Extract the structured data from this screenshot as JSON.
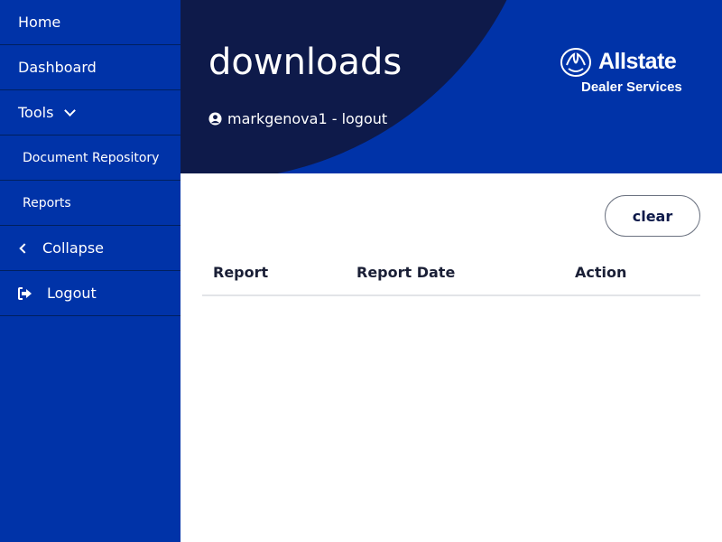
{
  "sidebar": {
    "items": [
      {
        "label": "Home"
      },
      {
        "label": "Dashboard"
      },
      {
        "label": "Tools"
      },
      {
        "label": "Document Repository"
      },
      {
        "label": "Reports"
      },
      {
        "label": "Collapse"
      },
      {
        "label": "Logout"
      }
    ]
  },
  "header": {
    "title": "downloads",
    "user_text": "markgenova1 - logout",
    "brand_name": "Allstate",
    "brand_subtitle": "Dealer Services"
  },
  "toolbar": {
    "clear_label": "clear"
  },
  "table": {
    "columns": [
      "Report",
      "Report Date",
      "Action"
    ],
    "rows": []
  },
  "colors": {
    "brand_blue": "#0033a8",
    "dark_navy": "#0e1a4a",
    "divider": "#00205e"
  }
}
